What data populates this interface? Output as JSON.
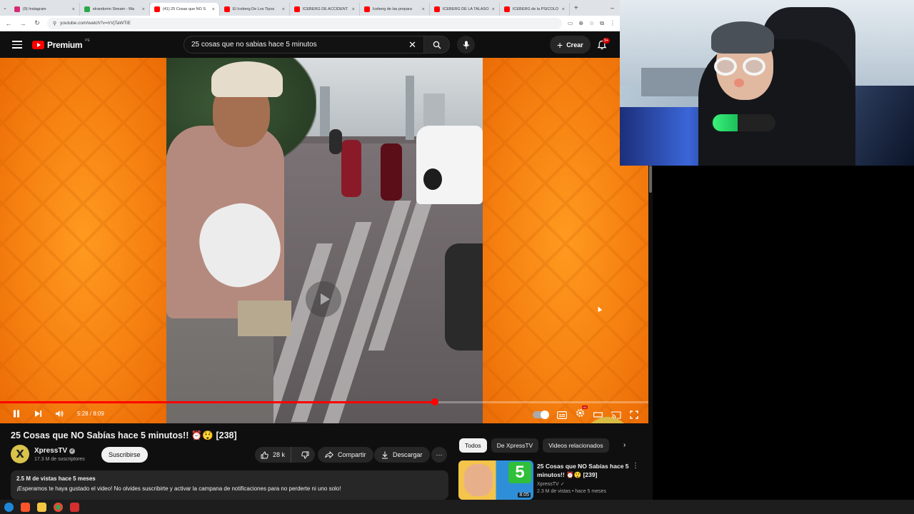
{
  "browser": {
    "tabs": [
      {
        "label": "(9) Instagram",
        "color": "#d62976",
        "active": false
      },
      {
        "label": "elrandomn Stream - Wa",
        "color": "#2aa84a",
        "active": false
      },
      {
        "label": "(41) 25 Cosas que NO S",
        "color": "#ff0000",
        "active": true
      },
      {
        "label": "El Iceberg De Los Tipos",
        "color": "#ff0000",
        "active": false
      },
      {
        "label": "ICEBERG DE ACCIDENT",
        "color": "#ff0000",
        "active": false
      },
      {
        "label": "Iceberg de las prepara",
        "color": "#ff0000",
        "active": false
      },
      {
        "label": "ICEBERG DE LA TALASO",
        "color": "#ff0000",
        "active": false
      },
      {
        "label": "ICEBERG de la PSICOLO",
        "color": "#ff0000",
        "active": false
      }
    ],
    "new_tab_glyph": "+",
    "close_glyph": "×",
    "url": "youtube.com/watch?v=IrVjTaWTiE"
  },
  "header": {
    "logo_text": "Premium",
    "logo_country": "PE",
    "search_query": "25 cosas que no sabias hace 5 minutos",
    "create_label": "Crear",
    "notification_count": "9+"
  },
  "player": {
    "time": "5:28 / 8:09",
    "progress": 0.671,
    "brand_color": "#ff0000"
  },
  "video": {
    "title": "25 Cosas que NO Sabías hace 5 minutos!! ⏰😲 [238]",
    "channel": "XpressTV",
    "subscribers": "17.3 M de suscriptores",
    "subscribe_label": "Suscribirse",
    "likes": "28 k",
    "share_label": "Compartir",
    "download_label": "Descargar",
    "more_glyph": "⋯",
    "views_date": "2.5 M de vistas  hace 5 meses",
    "description": "¡Esperamos te haya gustado el video! No olvides suscribirte y activar la campana de notificaciones para no perderte ni uno solo!"
  },
  "sidebar": {
    "chips": [
      "Todos",
      "De XpressTV",
      "Videos relacionados"
    ],
    "next_glyph": "›",
    "recommendation": {
      "title": "25 Cosas que NO Sabías hace 5 minutos!! ⏰😲 [239]",
      "channel": "XpressTV",
      "meta": "2.3 M de vistas • hace 5 meses",
      "duration": "8:05",
      "thumb_badge": "5"
    }
  },
  "watermark": {
    "glyph": "X",
    "color": "#d9c34a"
  }
}
